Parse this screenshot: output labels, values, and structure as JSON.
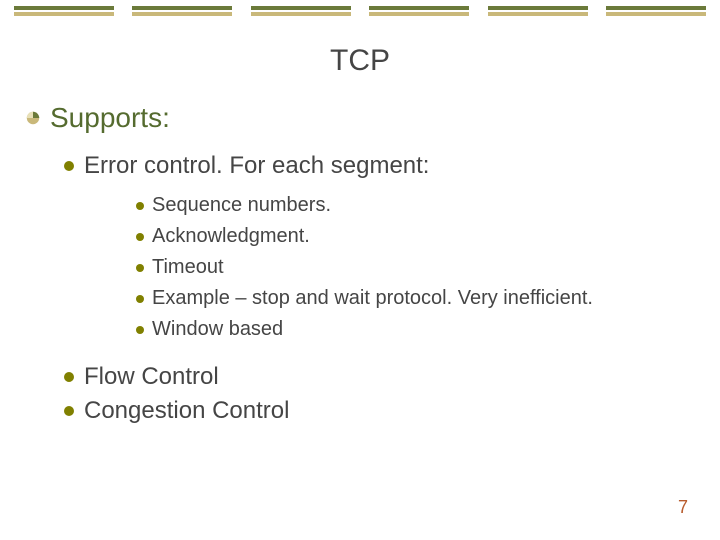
{
  "title": "TCP",
  "supports_label": "Supports:",
  "lvl1": {
    "error_control": "Error control. For each segment:",
    "flow_control": "Flow Control",
    "congestion_control": "Congestion Control"
  },
  "lvl2": {
    "sequence_numbers": "Sequence numbers.",
    "acknowledgment": "Acknowledgment.",
    "timeout": "Timeout",
    "example": "Example – stop and wait protocol. Very inefficient.",
    "window_based": "Window based"
  },
  "page_number": "7"
}
